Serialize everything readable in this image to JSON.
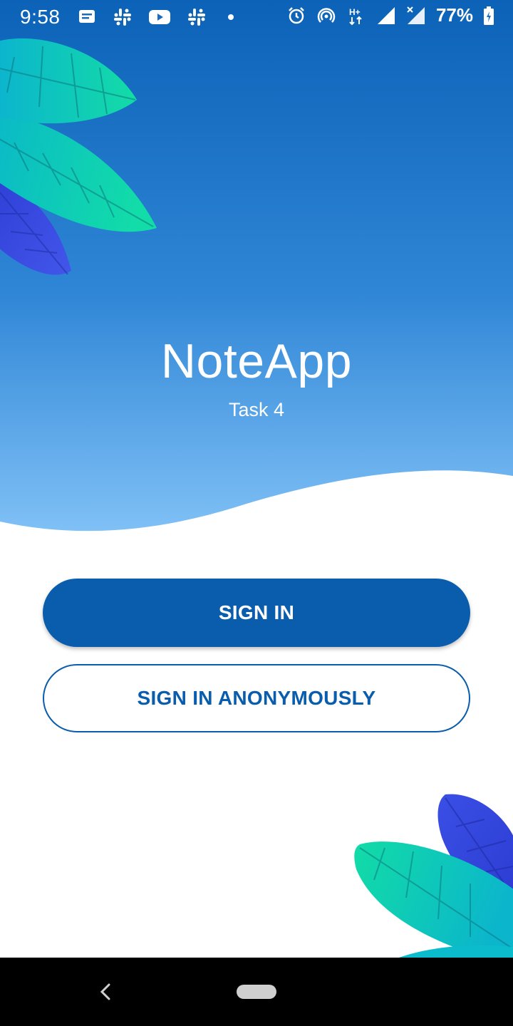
{
  "status_bar": {
    "time": "9:58",
    "battery": "77%",
    "left_icons": [
      "message-icon",
      "slack-icon",
      "youtube-icon",
      "slack-icon",
      "dot-icon"
    ],
    "right_icons": [
      "alarm-icon",
      "hotspot-icon",
      "hplus-data-icon",
      "signal-icon",
      "signal-x-icon",
      "battery-charging-icon"
    ]
  },
  "app": {
    "title": "NoteApp",
    "subtitle": "Task 4"
  },
  "buttons": {
    "sign_in": "SIGN IN",
    "sign_in_anonymously": "SIGN IN ANONYMOUSLY"
  },
  "colors": {
    "hero_top": "#0b64b8",
    "hero_bottom": "#7dbdf4",
    "primary": "#0a5dad",
    "leaf_green": "#12d8a8",
    "leaf_teal": "#0bb6cf",
    "leaf_blue": "#3a4fe0"
  },
  "navigation": {
    "back": "back-icon",
    "home": "home-pill"
  }
}
